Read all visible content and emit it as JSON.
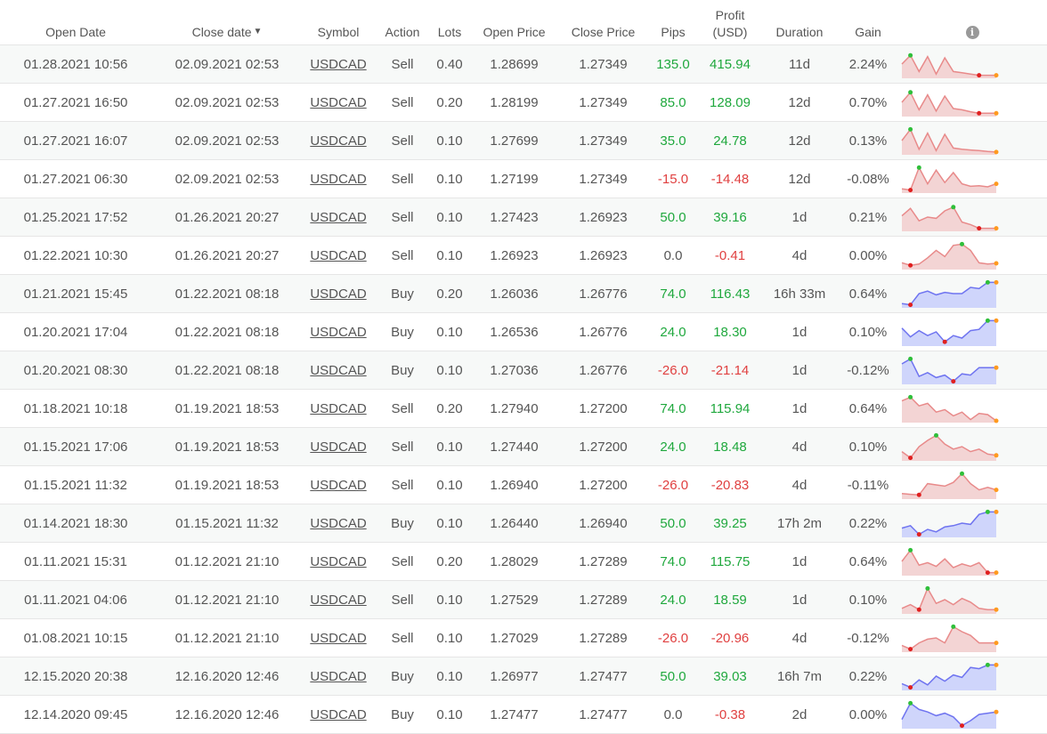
{
  "header": {
    "open_date": "Open Date",
    "close_date": "Close date",
    "sort_arrow": "▼",
    "symbol": "Symbol",
    "action": "Action",
    "lots": "Lots",
    "open_price": "Open Price",
    "close_price": "Close Price",
    "pips": "Pips",
    "profit_line1": "Profit",
    "profit_line2": "(USD)",
    "duration": "Duration",
    "gain": "Gain",
    "info_icon": "info-icon"
  },
  "colors": {
    "positive": "#1fa83d",
    "negative": "#e04040",
    "sell_line": "#e88a8a",
    "sell_fill": "#f3d4d4",
    "buy_line": "#6f74f0",
    "buy_fill": "#cfd5fb",
    "max_dot": "#2fbf3a",
    "min_dot": "#e02020",
    "end_dot": "#ff9a1f"
  },
  "trades": [
    {
      "open_date": "01.28.2021 10:56",
      "close_date": "02.09.2021 02:53",
      "symbol": "USDCAD",
      "action": "Sell",
      "lots": "0.40",
      "open_price": "1.28699",
      "close_price": "1.27349",
      "pips": "135.0",
      "profit": "415.94",
      "duration": "11d",
      "gain": "2.24%",
      "spark": [
        0.5,
        0.85,
        0.2,
        0.8,
        0.1,
        0.75,
        0.2,
        0.15,
        0.1,
        0.05,
        0.05,
        0.05
      ]
    },
    {
      "open_date": "01.27.2021 16:50",
      "close_date": "02.09.2021 02:53",
      "symbol": "USDCAD",
      "action": "Sell",
      "lots": "0.20",
      "open_price": "1.28199",
      "close_price": "1.27349",
      "pips": "85.0",
      "profit": "128.09",
      "duration": "12d",
      "gain": "0.70%",
      "spark": [
        0.5,
        0.9,
        0.2,
        0.8,
        0.15,
        0.75,
        0.25,
        0.2,
        0.12,
        0.06,
        0.06,
        0.06
      ]
    },
    {
      "open_date": "01.27.2021 16:07",
      "close_date": "02.09.2021 02:53",
      "symbol": "USDCAD",
      "action": "Sell",
      "lots": "0.10",
      "open_price": "1.27699",
      "close_price": "1.27349",
      "pips": "35.0",
      "profit": "24.78",
      "duration": "12d",
      "gain": "0.13%",
      "spark": [
        0.5,
        0.95,
        0.15,
        0.8,
        0.1,
        0.75,
        0.2,
        0.15,
        0.12,
        0.1,
        0.06,
        0.04
      ]
    },
    {
      "open_date": "01.27.2021 06:30",
      "close_date": "02.09.2021 02:53",
      "symbol": "USDCAD",
      "action": "Sell",
      "lots": "0.10",
      "open_price": "1.27199",
      "close_price": "1.27349",
      "pips": "-15.0",
      "profit": "-14.48",
      "duration": "12d",
      "gain": "-0.08%",
      "spark": [
        0.1,
        0.05,
        0.95,
        0.3,
        0.85,
        0.35,
        0.75,
        0.3,
        0.2,
        0.22,
        0.18,
        0.3
      ]
    },
    {
      "open_date": "01.25.2021 17:52",
      "close_date": "01.26.2021 20:27",
      "symbol": "USDCAD",
      "action": "Sell",
      "lots": "0.10",
      "open_price": "1.27423",
      "close_price": "1.26923",
      "pips": "50.0",
      "profit": "39.16",
      "duration": "1d",
      "gain": "0.21%",
      "spark": [
        0.55,
        0.85,
        0.35,
        0.5,
        0.45,
        0.75,
        0.9,
        0.3,
        0.2,
        0.05,
        0.05,
        0.05
      ]
    },
    {
      "open_date": "01.22.2021 10:30",
      "close_date": "01.26.2021 20:27",
      "symbol": "USDCAD",
      "action": "Sell",
      "lots": "0.10",
      "open_price": "1.26923",
      "close_price": "1.26923",
      "pips": "0.0",
      "profit": "-0.41",
      "duration": "4d",
      "gain": "0.00%",
      "spark": [
        0.2,
        0.1,
        0.15,
        0.4,
        0.7,
        0.45,
        0.9,
        0.95,
        0.7,
        0.2,
        0.15,
        0.18
      ]
    },
    {
      "open_date": "01.21.2021 15:45",
      "close_date": "01.22.2021 08:18",
      "symbol": "USDCAD",
      "action": "Buy",
      "lots": "0.20",
      "open_price": "1.26036",
      "close_price": "1.26776",
      "pips": "74.0",
      "profit": "116.43",
      "duration": "16h 33m",
      "gain": "0.64%",
      "spark": [
        0.1,
        0.05,
        0.5,
        0.6,
        0.45,
        0.55,
        0.5,
        0.5,
        0.75,
        0.7,
        0.95,
        0.95
      ]
    },
    {
      "open_date": "01.20.2021 17:04",
      "close_date": "01.22.2021 08:18",
      "symbol": "USDCAD",
      "action": "Buy",
      "lots": "0.10",
      "open_price": "1.26536",
      "close_price": "1.26776",
      "pips": "24.0",
      "profit": "18.30",
      "duration": "1d",
      "gain": "0.10%",
      "spark": [
        0.65,
        0.3,
        0.55,
        0.35,
        0.5,
        0.1,
        0.35,
        0.25,
        0.55,
        0.6,
        0.95,
        0.95
      ]
    },
    {
      "open_date": "01.20.2021 08:30",
      "close_date": "01.22.2021 08:18",
      "symbol": "USDCAD",
      "action": "Buy",
      "lots": "0.10",
      "open_price": "1.27036",
      "close_price": "1.26776",
      "pips": "-26.0",
      "profit": "-21.14",
      "duration": "1d",
      "gain": "-0.12%",
      "spark": [
        0.75,
        0.95,
        0.25,
        0.4,
        0.2,
        0.3,
        0.05,
        0.35,
        0.3,
        0.6,
        0.6,
        0.6
      ]
    },
    {
      "open_date": "01.18.2021 10:18",
      "close_date": "01.19.2021 18:53",
      "symbol": "USDCAD",
      "action": "Sell",
      "lots": "0.20",
      "open_price": "1.27940",
      "close_price": "1.27200",
      "pips": "74.0",
      "profit": "115.94",
      "duration": "1d",
      "gain": "0.64%",
      "spark": [
        0.8,
        0.95,
        0.6,
        0.7,
        0.35,
        0.45,
        0.2,
        0.35,
        0.05,
        0.3,
        0.25,
        0.0
      ]
    },
    {
      "open_date": "01.15.2021 17:06",
      "close_date": "01.19.2021 18:53",
      "symbol": "USDCAD",
      "action": "Sell",
      "lots": "0.10",
      "open_price": "1.27440",
      "close_price": "1.27200",
      "pips": "24.0",
      "profit": "18.48",
      "duration": "4d",
      "gain": "0.10%",
      "spark": [
        0.3,
        0.05,
        0.5,
        0.75,
        0.95,
        0.6,
        0.4,
        0.5,
        0.3,
        0.4,
        0.2,
        0.15
      ]
    },
    {
      "open_date": "01.15.2021 11:32",
      "close_date": "01.19.2021 18:53",
      "symbol": "USDCAD",
      "action": "Sell",
      "lots": "0.10",
      "open_price": "1.26940",
      "close_price": "1.27200",
      "pips": "-26.0",
      "profit": "-20.83",
      "duration": "4d",
      "gain": "-0.11%",
      "spark": [
        0.15,
        0.12,
        0.1,
        0.55,
        0.5,
        0.45,
        0.6,
        0.95,
        0.55,
        0.3,
        0.4,
        0.3
      ]
    },
    {
      "open_date": "01.14.2021 18:30",
      "close_date": "01.15.2021 11:32",
      "symbol": "USDCAD",
      "action": "Buy",
      "lots": "0.10",
      "open_price": "1.26440",
      "close_price": "1.26940",
      "pips": "50.0",
      "profit": "39.25",
      "duration": "17h 2m",
      "gain": "0.22%",
      "spark": [
        0.3,
        0.4,
        0.05,
        0.25,
        0.15,
        0.35,
        0.4,
        0.5,
        0.45,
        0.85,
        0.95,
        0.95
      ]
    },
    {
      "open_date": "01.11.2021 15:31",
      "close_date": "01.12.2021 21:10",
      "symbol": "USDCAD",
      "action": "Sell",
      "lots": "0.20",
      "open_price": "1.28029",
      "close_price": "1.27289",
      "pips": "74.0",
      "profit": "115.75",
      "duration": "1d",
      "gain": "0.64%",
      "spark": [
        0.5,
        0.95,
        0.35,
        0.45,
        0.3,
        0.6,
        0.25,
        0.4,
        0.3,
        0.45,
        0.05,
        0.05
      ]
    },
    {
      "open_date": "01.11.2021 04:06",
      "close_date": "01.12.2021 21:10",
      "symbol": "USDCAD",
      "action": "Sell",
      "lots": "0.10",
      "open_price": "1.27529",
      "close_price": "1.27289",
      "pips": "24.0",
      "profit": "18.59",
      "duration": "1d",
      "gain": "0.10%",
      "spark": [
        0.15,
        0.3,
        0.1,
        0.95,
        0.35,
        0.5,
        0.3,
        0.55,
        0.4,
        0.15,
        0.1,
        0.1
      ]
    },
    {
      "open_date": "01.08.2021 10:15",
      "close_date": "01.12.2021 21:10",
      "symbol": "USDCAD",
      "action": "Sell",
      "lots": "0.10",
      "open_price": "1.27029",
      "close_price": "1.27289",
      "pips": "-26.0",
      "profit": "-20.96",
      "duration": "4d",
      "gain": "-0.12%",
      "spark": [
        0.2,
        0.05,
        0.3,
        0.45,
        0.5,
        0.3,
        0.95,
        0.75,
        0.6,
        0.3,
        0.3,
        0.3
      ]
    },
    {
      "open_date": "12.15.2020 20:38",
      "close_date": "12.16.2020 12:46",
      "symbol": "USDCAD",
      "action": "Buy",
      "lots": "0.10",
      "open_price": "1.26977",
      "close_price": "1.27477",
      "pips": "50.0",
      "profit": "39.03",
      "duration": "16h 7m",
      "gain": "0.22%",
      "spark": [
        0.2,
        0.05,
        0.35,
        0.15,
        0.5,
        0.3,
        0.55,
        0.45,
        0.85,
        0.8,
        0.95,
        0.95
      ]
    },
    {
      "open_date": "12.14.2020 09:45",
      "close_date": "12.16.2020 12:46",
      "symbol": "USDCAD",
      "action": "Buy",
      "lots": "0.10",
      "open_price": "1.27477",
      "close_price": "1.27477",
      "pips": "0.0",
      "profit": "-0.38",
      "duration": "2d",
      "gain": "0.00%",
      "spark": [
        0.3,
        0.95,
        0.7,
        0.6,
        0.45,
        0.55,
        0.4,
        0.05,
        0.25,
        0.5,
        0.55,
        0.6
      ]
    }
  ]
}
